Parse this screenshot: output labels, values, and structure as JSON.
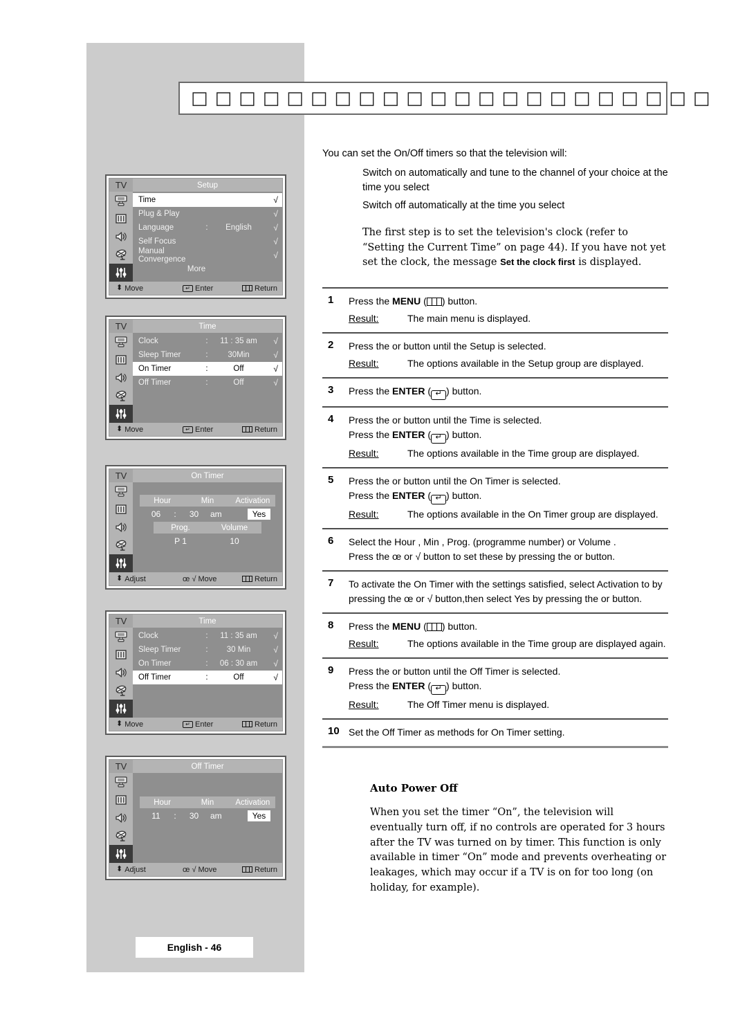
{
  "title_bar": {
    "tofu": "□□□□□□□□□□□□□□□□□□□□□□"
  },
  "intro": {
    "lead": "You can set the On/Off timers so that the television will:",
    "bullets": [
      "Switch on automatically and tune to the channel of your choice at the time you select",
      "Switch off automatically at the time you select"
    ],
    "note_part1": "The first step is to set the television's clock (refer to “Setting the Current Time” on page 44). If you have not yet set the clock,  the message ",
    "note_osd": "Set the clock first",
    "note_part2": "                is displayed."
  },
  "steps": [
    {
      "num": "1",
      "line1_pre": "Press the ",
      "line1_strong": "MENU",
      "line1_icon": "menu-icon",
      "line1_post": " button.",
      "result_label": "Result:",
      "result_text": "The main menu is displayed."
    },
    {
      "num": "2",
      "line1_plain": "Press the      or      button until the Setup  is selected.",
      "result_label": "Result:",
      "result_text": "The options available in the Setup  group are displayed."
    },
    {
      "num": "3",
      "line1_pre": "Press the ",
      "line1_strong": "ENTER",
      "line1_icon": "enter-icon",
      "line1_post": " button."
    },
    {
      "num": "4",
      "line1_plain": "Press the      or      button until the Time  is selected.",
      "line2_pre": "Press the ",
      "line2_strong": "ENTER",
      "line2_icon": "enter-icon",
      "line2_post": " button.",
      "result_label": "Result:",
      "result_text": "The options available in the Time  group are displayed."
    },
    {
      "num": "5",
      "line1_plain": "Press the      or      button until the On Timer   is selected.",
      "line2_pre": "Press the ",
      "line2_strong": "ENTER",
      "line2_icon": "enter-icon",
      "line2_post": " button.",
      "result_label": "Result:",
      "result_text": "The options available in the On Timer   group are displayed."
    },
    {
      "num": "6",
      "line1_plain": "Select the Hour , Min , Prog.   (programme number) or Volume .",
      "line2_plain": "Press the œ or √ button to set these by pressing the      or  button."
    },
    {
      "num": "7",
      "line1_plain": "To activate the On Timer   with the settings satisfied, select Activation      to by pressing the œ or √ button,then select Yes by pressing the      or      button."
    },
    {
      "num": "8",
      "line1_pre": "Press the ",
      "line1_strong": "MENU",
      "line1_icon": "menu-icon",
      "line1_post": " button.",
      "result_label": "Result:",
      "result_text": "The options available in the Time  group are displayed again."
    },
    {
      "num": "9",
      "line1_plain": "Press the      or      button until the Off Timer    is selected.",
      "line2_pre": "Press the ",
      "line2_strong": "ENTER",
      "line2_icon": "enter-icon",
      "line2_post": " button.",
      "result_label": "Result:",
      "result_text": "The Off Timer    menu is displayed."
    },
    {
      "num": "10",
      "line1_plain": "Set the Off Timer    as methods for On Timer   setting."
    }
  ],
  "auto_power_off": {
    "heading": "Auto Power Off",
    "body": "When you set the timer “On”, the television will eventually turn off, if no controls are operated for 3 hours after the TV was turned on by timer. This function is only available in timer “On” mode and prevents overheating or leakages, which may occur if a TV is on for too long (on holiday, for example)."
  },
  "footer": {
    "page_label": "English - 46"
  },
  "osd_common": {
    "tv_tag": "TV",
    "foot_move": "Move",
    "foot_enter": "Enter",
    "foot_return": "Return",
    "foot_adjust": "Adjust",
    "check_glyph": "√",
    "colon": ":",
    "move_arrows": "œ √"
  },
  "osd_screens": [
    {
      "id": "setup",
      "title": "Setup",
      "rows": [
        {
          "label": "Time",
          "colon": "",
          "value": "",
          "check": "√",
          "selected": true
        },
        {
          "label": "Plug & Play",
          "colon": "",
          "value": "",
          "check": "√",
          "selected": false
        },
        {
          "label": "Language",
          "colon": ":",
          "value": "English",
          "check": "√",
          "selected": false
        },
        {
          "label": "Self Focus",
          "colon": "",
          "value": "",
          "check": "√",
          "selected": false
        },
        {
          "label": "Manual Convergence",
          "colon": "",
          "value": "",
          "check": "√",
          "selected": false
        }
      ],
      "more": "More",
      "foot_left": "Move",
      "foot_mid": "Enter",
      "foot_right": "Return"
    },
    {
      "id": "time-1",
      "title": "Time",
      "rows": [
        {
          "label": "Clock",
          "colon": ":",
          "value": "11 : 35     am",
          "check": "√",
          "selected": false
        },
        {
          "label": "Sleep Timer",
          "colon": ":",
          "value": "30Min",
          "check": "√",
          "selected": false
        },
        {
          "label": "On Timer",
          "colon": ":",
          "value": "Off",
          "check": "√",
          "selected": true
        },
        {
          "label": "Off Timer",
          "colon": ":",
          "value": "Off",
          "check": "√",
          "selected": false
        }
      ],
      "foot_left": "Move",
      "foot_mid": "Enter",
      "foot_right": "Return"
    },
    {
      "id": "on-timer",
      "title": "On Timer",
      "band1": {
        "hour": "Hour",
        "min": "Min",
        "activation": "Activation"
      },
      "values1": {
        "hour": "06",
        "colon": ":",
        "min": "30",
        "ampm": "am",
        "activation": "Yes"
      },
      "band2": {
        "prog": "Prog.",
        "volume": "Volume"
      },
      "values2": {
        "prog": "P  1",
        "volume": "10"
      },
      "foot_left": "Adjust",
      "foot_mid": "Move",
      "foot_right": "Return"
    },
    {
      "id": "time-2",
      "title": "Time",
      "rows": [
        {
          "label": "Clock",
          "colon": ":",
          "value": "11 : 35     am",
          "check": "√",
          "selected": false
        },
        {
          "label": "Sleep Timer",
          "colon": ":",
          "value": "30 Min",
          "check": "√",
          "selected": false
        },
        {
          "label": "On Timer",
          "colon": ":",
          "value": "06 : 30     am",
          "check": "√",
          "selected": false
        },
        {
          "label": "Off Timer",
          "colon": ":",
          "value": "Off",
          "check": "√",
          "selected": true
        }
      ],
      "foot_left": "Move",
      "foot_mid": "Enter",
      "foot_right": "Return"
    },
    {
      "id": "off-timer",
      "title": "Off Timer",
      "band1": {
        "hour": "Hour",
        "min": "Min",
        "activation": "Activation"
      },
      "values1": {
        "hour": "11",
        "colon": ":",
        "min": "30",
        "ampm": "am",
        "activation": "Yes"
      },
      "foot_left": "Adjust",
      "foot_mid": "Move",
      "foot_right": "Return"
    }
  ],
  "colors": {
    "page_grey": "#cccccc",
    "osd_body": "#8f8f8f",
    "osd_chrome": "#b4b4b4",
    "osd_band": "#b0b0b0",
    "selected_row": "#ffffff",
    "active_icon": "#3a3a3a"
  }
}
